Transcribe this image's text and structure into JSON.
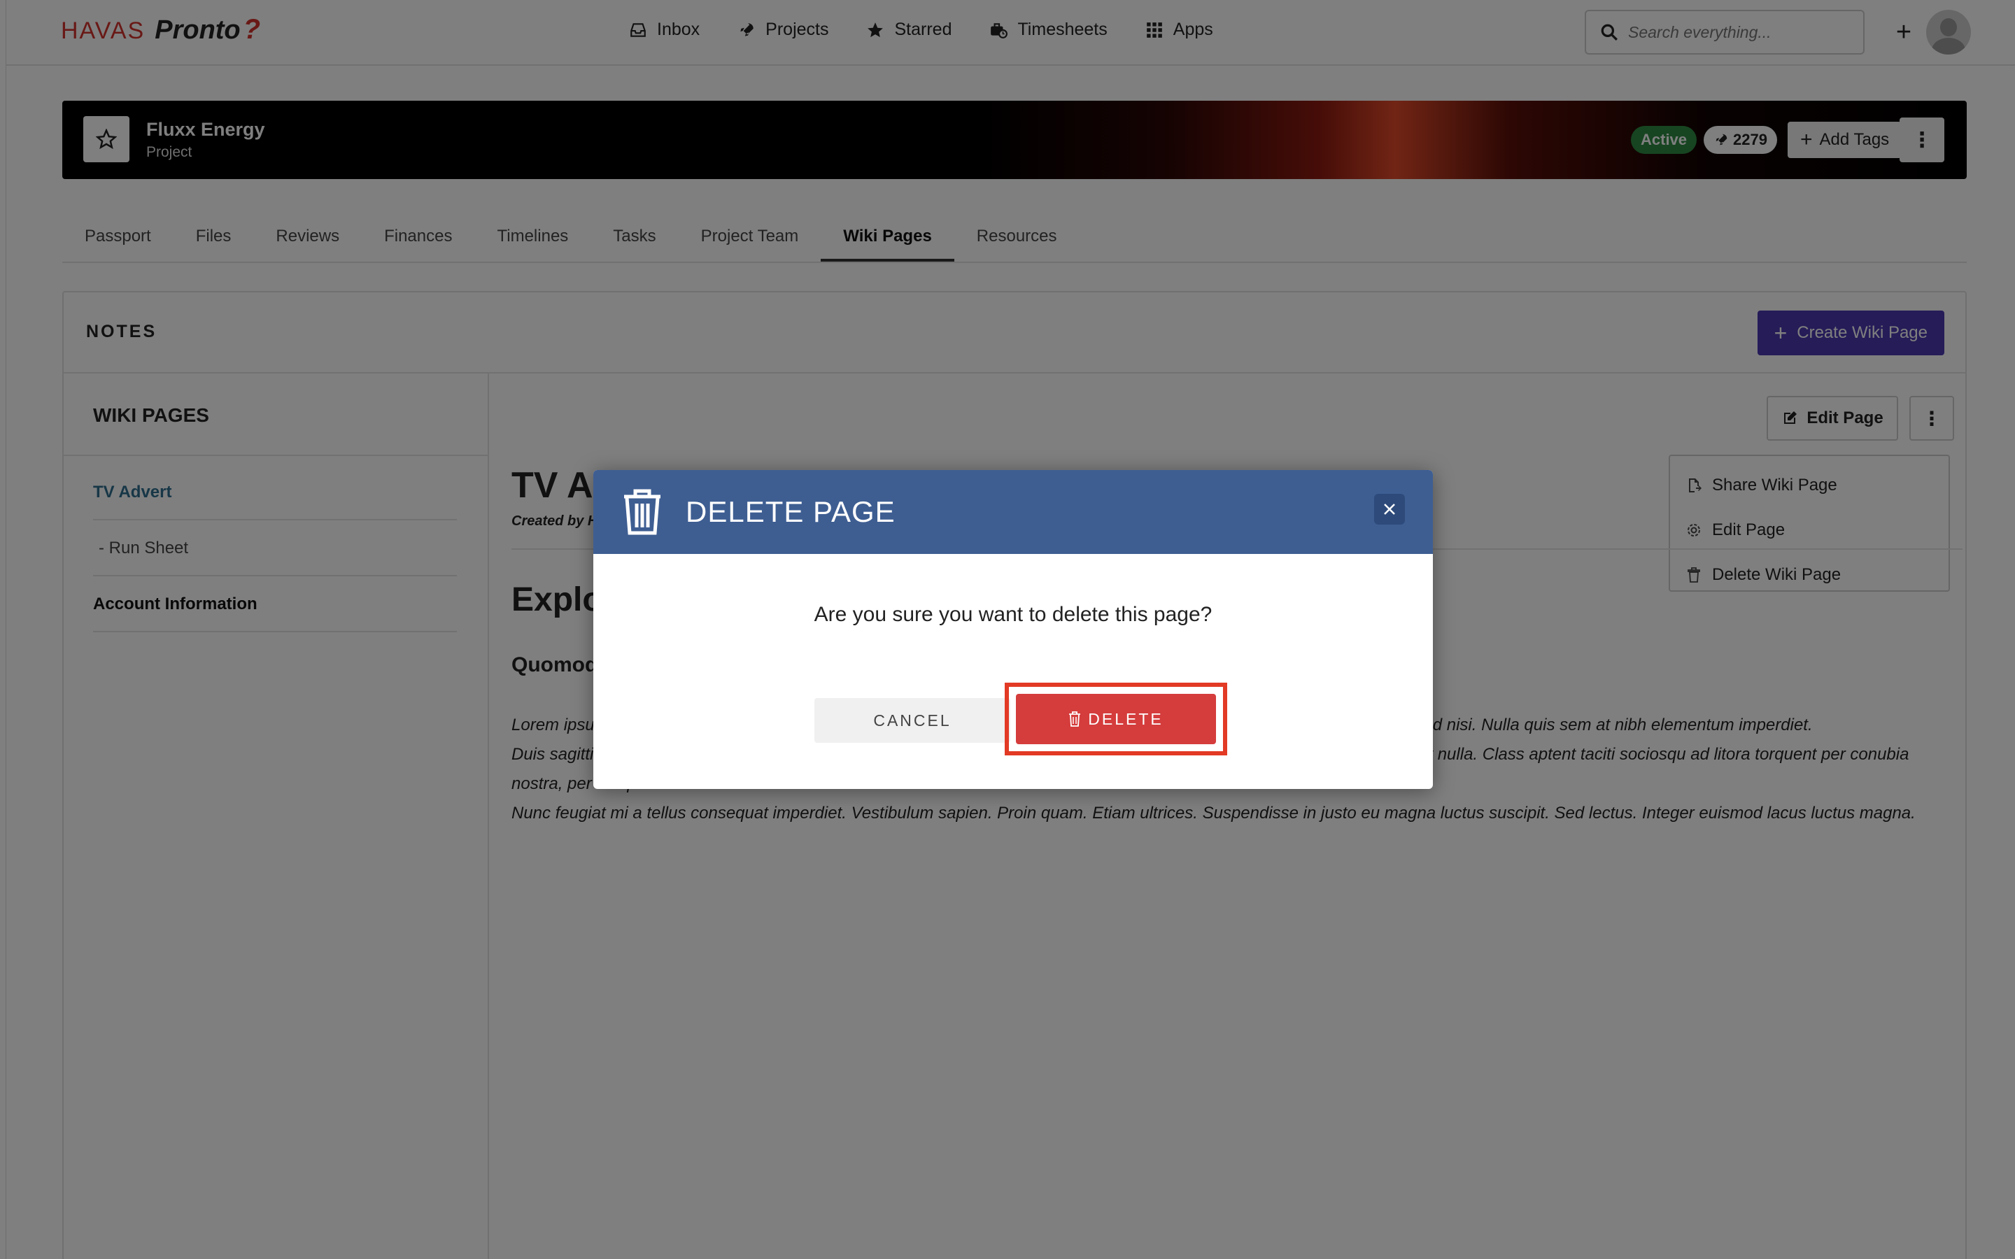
{
  "nav": {
    "logo_brand": "HAVAS",
    "logo_product": "Pronto",
    "logo_mark": "?",
    "links": [
      {
        "label": "Inbox",
        "icon": "inbox-icon"
      },
      {
        "label": "Projects",
        "icon": "rocket-icon"
      },
      {
        "label": "Starred",
        "icon": "star-icon"
      },
      {
        "label": "Timesheets",
        "icon": "timesheets-icon"
      },
      {
        "label": "Apps",
        "icon": "grid-icon"
      }
    ],
    "search_placeholder": "Search everything...",
    "add_label": "+"
  },
  "project": {
    "name": "Fluxx Energy",
    "type": "Project",
    "status": "Active",
    "count": "2279",
    "add_tags": "Add Tags",
    "menu": "⋮"
  },
  "tabs": [
    {
      "label": "Passport"
    },
    {
      "label": "Files"
    },
    {
      "label": "Reviews"
    },
    {
      "label": "Finances"
    },
    {
      "label": "Timelines"
    },
    {
      "label": "Tasks"
    },
    {
      "label": "Project Team"
    },
    {
      "label": "Wiki Pages",
      "active": true
    },
    {
      "label": "Resources"
    }
  ],
  "notes": {
    "title": "NOTES",
    "create_button": "Create Wiki Page",
    "sidebar_title": "WIKI PAGES",
    "sidebar_items": [
      {
        "label": "TV Advert",
        "color": "#2f6f8f"
      },
      {
        "label": "- Run Sheet"
      },
      {
        "label": "Account Information"
      }
    ],
    "edit_page": "Edit Page",
    "menu_items": [
      {
        "label": "Share Wiki Page"
      },
      {
        "label": "Edit Page"
      },
      {
        "label": "Delete Wiki Page"
      }
    ],
    "page_title": "TV Ac",
    "created_by": "Created by He",
    "heading2": "Explo",
    "heading3": "Quomod",
    "paragraphs": [
      "Lorem ipsum dolor sit amet, consectetur adipiscing elit. Integer nec odio. Praesent libero. Sed cursus ante dapibus diam. Sed nisi. Nulla quis sem at nibh elementum imperdiet.",
      "Duis sagittis ipsum. Praesent mauris. Fusce nec tellus sed augue semper porta. Mauris massa. Vestibulum lacinia arcu eget nulla. Class aptent taciti sociosqu ad litora torquent per conubia nostra, per inceptos himenaeos.",
      "Nunc feugiat mi a tellus consequat imperdiet. Vestibulum sapien. Proin quam. Etiam ultrices. Suspendisse in justo eu magna luctus suscipit. Sed lectus. Integer euismod lacus luctus magna."
    ]
  },
  "modal": {
    "title": "DELETE PAGE",
    "message": "Are you sure you want to delete this page?",
    "cancel": "CANCEL",
    "delete": "DELETE",
    "header_color": "#3e5e92",
    "delete_color": "#d53c3c",
    "highlight_color": "#e23a25"
  }
}
